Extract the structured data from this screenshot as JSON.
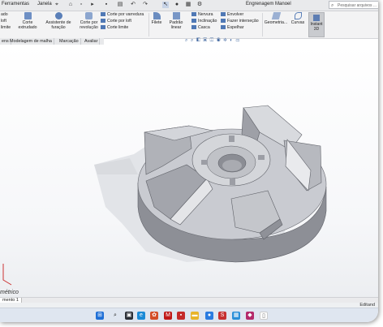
{
  "titlebar": {
    "menu": [
      "Ferramentas",
      "Janela"
    ],
    "document_title": "Engrenagem Manoel",
    "search_placeholder": "Pesquisar arquivos ..."
  },
  "ribbon": {
    "left_partial": [
      "ado",
      "loft",
      "limite"
    ],
    "corte_extrudado": "Corte extrudado",
    "assistente": "Assistente de furação",
    "corte_revolucao": "Corte por revolução",
    "corte_varredura": "Corte por varredura",
    "corte_loft": "Corte por loft",
    "corte_limite": "Corte limite",
    "filete": "Filete",
    "padrao_linear": "Padrão linear",
    "nervura": "Nervura",
    "inclinacao": "Inclinação",
    "casca": "Casca",
    "envolver": "Envolver",
    "fazer_intersecao": "Fazer interseção",
    "espelhar": "Espelhar",
    "geometria": "Geometria...",
    "curvas": "Curvas",
    "instant3d": "Instant 3D"
  },
  "tabs": [
    "ens",
    "Modelagem de malha",
    "Marcação",
    "Avaliar"
  ],
  "viewport": {
    "view_label": "métrico"
  },
  "bottom": {
    "doc_tab": "mento 1",
    "status": "Editand"
  },
  "taskbar_icons": [
    "windows-icon",
    "search-icon",
    "taskview-icon",
    "edge-icon",
    "photos-icon",
    "mcafee-icon",
    "app-icon",
    "folder-icon",
    "chrome-icon",
    "solidworks-icon",
    "store-icon",
    "app2-icon",
    "file-icon"
  ]
}
